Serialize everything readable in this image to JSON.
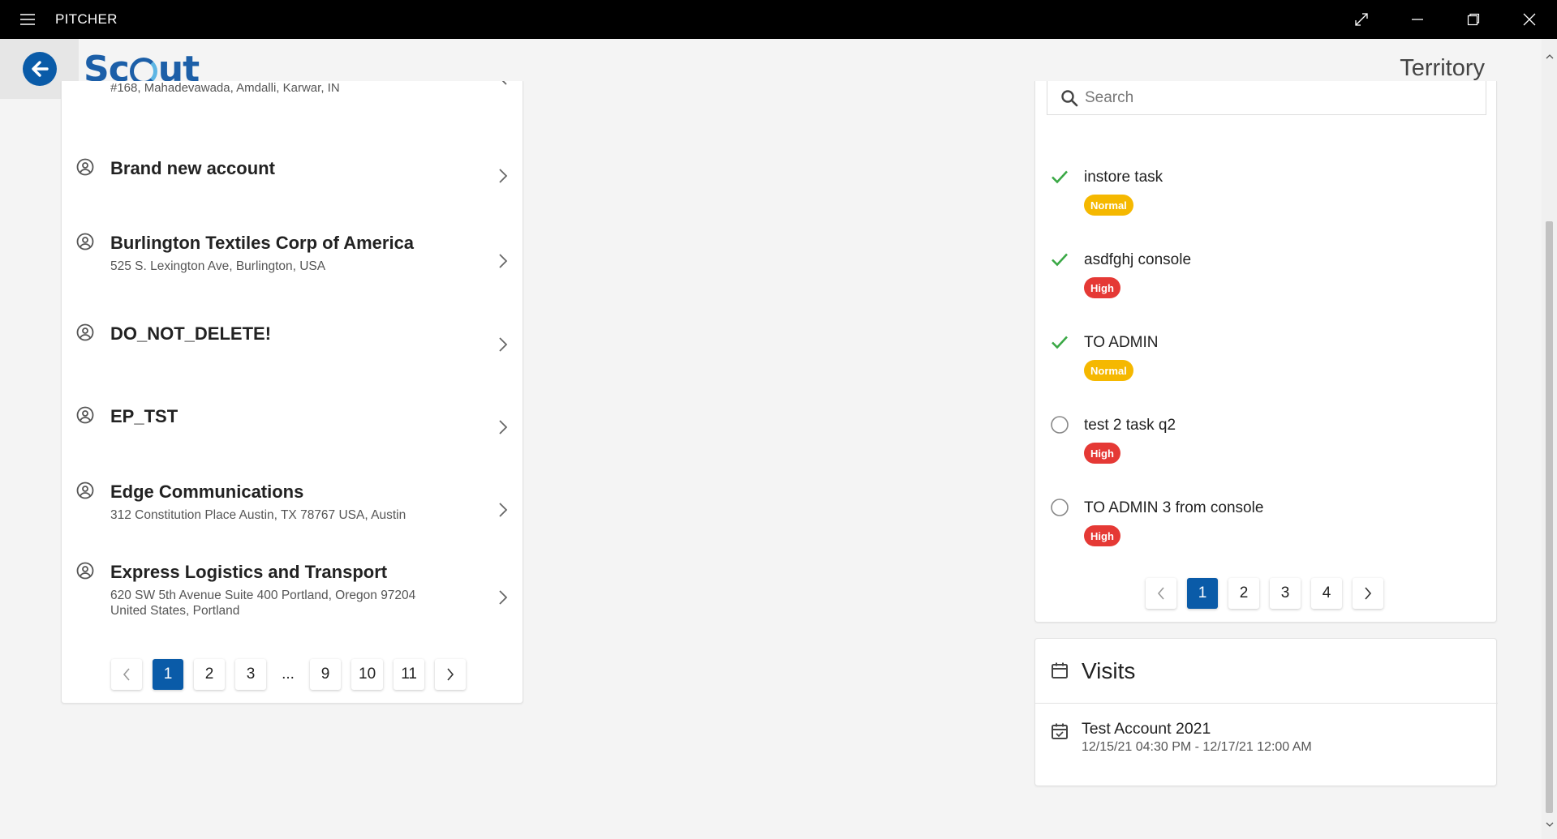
{
  "window": {
    "app_title": "PITCHER",
    "icons": [
      "hamburger-icon",
      "expand-icon",
      "minimize-icon",
      "restore-icon",
      "close-icon"
    ]
  },
  "header": {
    "logo_prefix": "Sc",
    "logo_suffix": "ut",
    "page_title": "Territory",
    "back_icon": "arrow-left-icon"
  },
  "accounts": {
    "partial_item_address": "#168, Mahadevawada, Amdalli, Karwar, IN",
    "items": [
      {
        "name": "Brand new account",
        "address": ""
      },
      {
        "name": "Burlington Textiles Corp of America",
        "address": "525 S. Lexington Ave, Burlington, USA"
      },
      {
        "name": "DO_NOT_DELETE!",
        "address": ""
      },
      {
        "name": "EP_TST",
        "address": ""
      },
      {
        "name": "Edge Communications",
        "address": "312 Constitution Place Austin, TX 78767 USA, Austin"
      },
      {
        "name": "Express Logistics and Transport",
        "address": "620 SW 5th Avenue Suite 400 Portland, Oregon 97204 United States, Portland"
      }
    ],
    "pagination": {
      "pages": [
        "1",
        "2",
        "3",
        "...",
        "9",
        "10",
        "11"
      ],
      "active": "1"
    }
  },
  "tasks": {
    "search_placeholder": "Search",
    "items": [
      {
        "title": "instore task",
        "priority": "Normal",
        "done": true
      },
      {
        "title": "asdfghj console",
        "priority": "High",
        "done": true
      },
      {
        "title": "TO ADMIN",
        "priority": "Normal",
        "done": true
      },
      {
        "title": "test 2 task q2",
        "priority": "High",
        "done": false
      },
      {
        "title": "TO ADMIN 3 from console",
        "priority": "High",
        "done": false
      }
    ],
    "pagination": {
      "pages": [
        "1",
        "2",
        "3",
        "4"
      ],
      "active": "1"
    }
  },
  "visits": {
    "title": "Visits",
    "items": [
      {
        "name": "Test Account 2021",
        "time": "12/15/21 04:30 PM - 12/17/21 12:00 AM"
      }
    ]
  },
  "colors": {
    "brand": "#0a5ba8",
    "check": "#3aa845",
    "normal_badge": "#f5b800",
    "high_badge": "#e53935"
  }
}
